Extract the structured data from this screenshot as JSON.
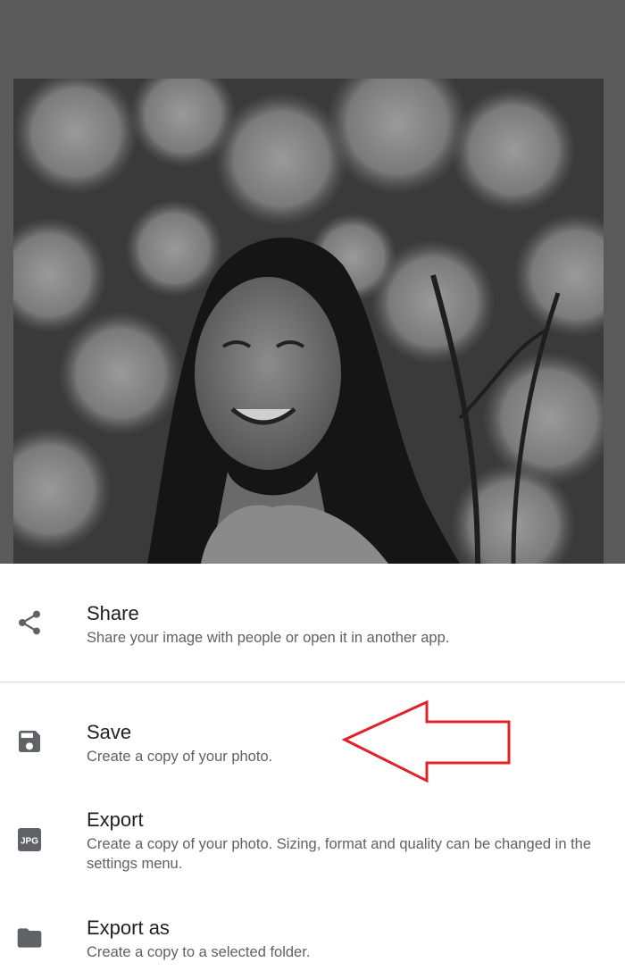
{
  "preview": {
    "image_label": "photo-of-smiling-woman-in-front-of-white-flowers"
  },
  "sheet": {
    "items": [
      {
        "icon": "share-icon",
        "title": "Share",
        "description": "Share your image with people or open it in another app."
      },
      {
        "icon": "save-icon",
        "title": "Save",
        "description": "Create a copy of your photo."
      },
      {
        "icon": "jpg-icon",
        "icon_text": "JPG",
        "title": "Export",
        "description": "Create a copy of your photo. Sizing, format and quality can be changed in the settings menu."
      },
      {
        "icon": "folder-icon",
        "title": "Export as",
        "description": "Create a copy to a selected folder."
      }
    ]
  },
  "colors": {
    "backdrop": "#5a5a5a",
    "sheet_background": "#ffffff",
    "icon_gray": "#5f6368",
    "title_text": "#212121",
    "description_text": "#616161",
    "annotation_arrow": "#e0232b"
  }
}
